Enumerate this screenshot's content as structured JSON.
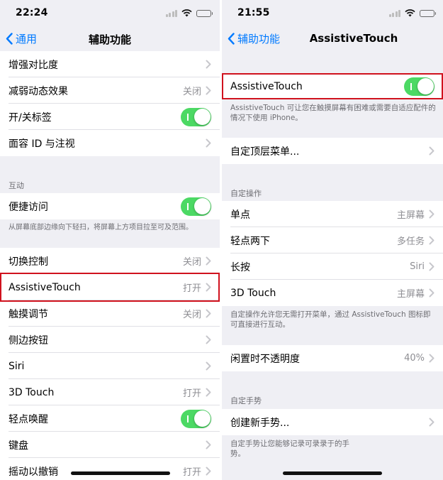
{
  "left": {
    "status_time": "22:24",
    "back_label": "通用",
    "title": "辅助功能",
    "group1": [
      {
        "label": "增强对比度",
        "value": ""
      },
      {
        "label": "减弱动态效果",
        "value": "关闭"
      },
      {
        "label": "开/关标签",
        "toggle": true
      },
      {
        "label": "面容 ID 与注视",
        "value": ""
      }
    ],
    "section_header": "互动",
    "reach_label": "便捷访问",
    "reach_footer": "从屏幕底部边缘向下轻扫，将屏幕上方项目拉至可及范围。",
    "group2": [
      {
        "label": "切换控制",
        "value": "关闭"
      },
      {
        "label": "AssistiveTouch",
        "value": "打开"
      },
      {
        "label": "触摸调节",
        "value": "关闭"
      },
      {
        "label": "侧边按钮",
        "value": ""
      },
      {
        "label": "Siri",
        "value": ""
      },
      {
        "label": "3D Touch",
        "value": "打开"
      },
      {
        "label": "轻点唤醒",
        "toggle": true
      },
      {
        "label": "键盘",
        "value": ""
      },
      {
        "label": "摇动以撤销",
        "value": "打开"
      }
    ]
  },
  "right": {
    "status_time": "21:55",
    "back_label": "辅助功能",
    "title": "AssistiveTouch",
    "main_toggle_label": "AssistiveTouch",
    "main_footer": "AssistiveTouch 可让您在触摸屏幕有困难或需要自适应配件的情况下使用 iPhone。",
    "top_menu_label": "自定顶层菜单...",
    "custom_actions_header": "自定操作",
    "actions": [
      {
        "label": "单点",
        "value": "主屏幕"
      },
      {
        "label": "轻点两下",
        "value": "多任务"
      },
      {
        "label": "长按",
        "value": "Siri"
      },
      {
        "label": "3D Touch",
        "value": "主屏幕"
      }
    ],
    "actions_footer": "自定操作允许您无需打开菜单，通过 AssistiveTouch 图标即可直接进行互动。",
    "idle_label": "闲置时不透明度",
    "idle_value": "40%",
    "gestures_header": "自定手势",
    "new_gesture_label": "创建新手势...",
    "gestures_footer": "自定手势让您能够记录可录录于的手势。"
  },
  "colors": {
    "accent": "#007aff",
    "toggle_on": "#4cd964",
    "highlight": "#d0121e"
  }
}
